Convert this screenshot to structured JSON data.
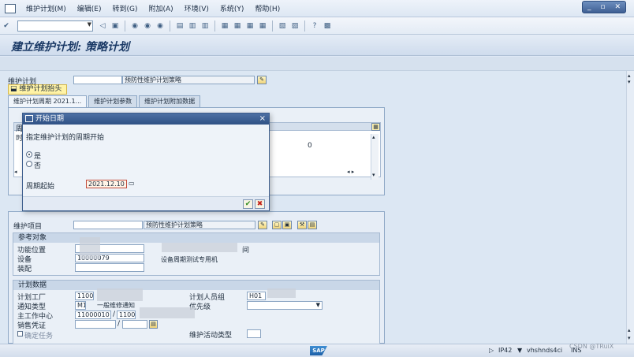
{
  "menu": {
    "items": [
      "维护计划(M)",
      "编辑(E)",
      "转到(G)",
      "附加(A)",
      "环境(V)",
      "系统(Y)",
      "帮助(H)"
    ]
  },
  "toolbar": {
    "command_value": "",
    "icons": [
      "enter-icon",
      "back-icon",
      "save-icon",
      "back-nav-icon",
      "exit-icon",
      "cancel-icon",
      "print-icon",
      "find-icon",
      "find-next-icon",
      "first-page-icon",
      "prev-page-icon",
      "next-page-icon",
      "last-page-icon",
      "new-session-icon",
      "shortcut-icon",
      "help-icon",
      "layout-icon"
    ]
  },
  "title": "建立维护计划: 策略计划",
  "plan": {
    "label": "维护计划",
    "value": "",
    "description": "预防性维护计划策略",
    "header_button": "维护计划抬头"
  },
  "tabs": [
    "维护计划周期 2021.1...",
    "维护计划参数",
    "维护计划附加数据"
  ],
  "grid": {
    "col_partial": "周",
    "row_partial": "时",
    "value": "0"
  },
  "dialog": {
    "title": "开始日期",
    "question": "指定维护计划的周期开始",
    "option_yes": "是",
    "option_no": "否",
    "selected": "yes",
    "start_label": "周期起始",
    "start_value": "2021.12.10"
  },
  "item": {
    "label": "维护项目",
    "value": "",
    "description": "预防性维护计划策略"
  },
  "reference": {
    "title": "参考对象",
    "function_location_label": "功能位置",
    "equipment_label": "设备",
    "equipment_value": "10000079",
    "equipment_desc_partial": "设备周期测试专用机",
    "function_location_suffix": "间",
    "assembly_label": "装配"
  },
  "planning": {
    "title": "计划数据",
    "plant_label": "计划工厂",
    "plant_value": "1100",
    "planner_group_label": "计划人员组",
    "planner_group_value": "H01",
    "notif_type_label": "通知类型",
    "notif_type_value": "M1",
    "notif_type_desc": "一般维修通知",
    "priority_label": "优先级",
    "work_center_label": "主工作中心",
    "work_center_value": "11000010",
    "work_center_plant": "1100",
    "sales_doc_label": "销售凭证",
    "activity_type_label": "维护活动类型",
    "confirm_task_label": "确定任务"
  },
  "status": {
    "system": "IP42",
    "host": "vhshnds4ci",
    "mode": "INS",
    "watermark": "CSDN @TRuiX"
  }
}
